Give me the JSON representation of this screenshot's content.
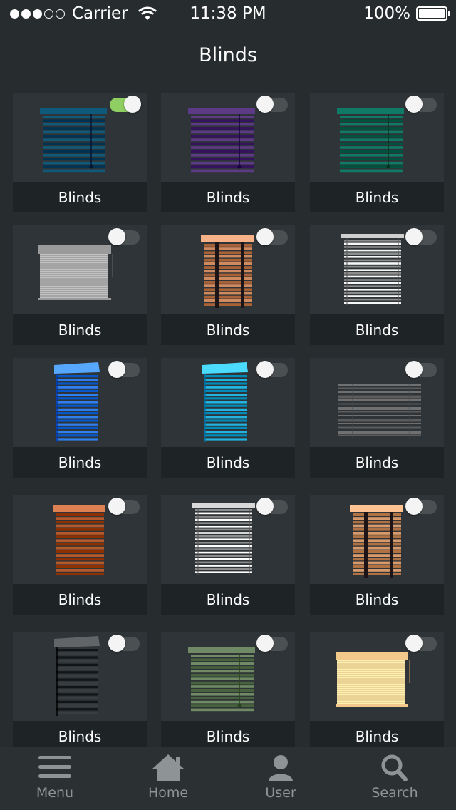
{
  "status_bar": {
    "carrier": "Carrier",
    "time": "11:38 PM",
    "battery": "100%"
  },
  "header": {
    "title": "Blinds"
  },
  "tiles": [
    {
      "label": "Blinds",
      "toggle_on": true,
      "art": "venetian",
      "color": "#0f5a7a"
    },
    {
      "label": "Blinds",
      "toggle_on": false,
      "art": "venetian",
      "color": "#5d3a86"
    },
    {
      "label": "Blinds",
      "toggle_on": false,
      "art": "venetian",
      "color": "#0f7a66"
    },
    {
      "label": "Blinds",
      "toggle_on": false,
      "art": "roller",
      "color": "#9a9a9a"
    },
    {
      "label": "Blinds",
      "toggle_on": false,
      "art": "wood",
      "color": "#d08a60"
    },
    {
      "label": "Blinds",
      "toggle_on": false,
      "art": "slat",
      "color": "#cfcfcf"
    },
    {
      "label": "Blinds",
      "toggle_on": false,
      "art": "slat3d",
      "color": "#2f7ff0"
    },
    {
      "label": "Blinds",
      "toggle_on": false,
      "art": "slat3d",
      "color": "#22b3e0"
    },
    {
      "label": "Blinds",
      "toggle_on": false,
      "art": "open",
      "color": "#707070"
    },
    {
      "label": "Blinds",
      "toggle_on": false,
      "art": "wood_plain",
      "color": "#b5582a"
    },
    {
      "label": "Blinds",
      "toggle_on": false,
      "art": "slat",
      "color": "#d8d8d8"
    },
    {
      "label": "Blinds",
      "toggle_on": false,
      "art": "wood",
      "color": "#d89a6a"
    },
    {
      "label": "Blinds",
      "toggle_on": false,
      "art": "slat3d",
      "color": "#3a3d40"
    },
    {
      "label": "Blinds",
      "toggle_on": false,
      "art": "venetian",
      "color": "#6f8a64"
    },
    {
      "label": "Blinds",
      "toggle_on": false,
      "art": "roller",
      "color": "#f1c98a"
    }
  ],
  "tabbar": {
    "tabs": [
      {
        "label": "Menu",
        "icon": "menu-icon"
      },
      {
        "label": "Home",
        "icon": "home-icon"
      },
      {
        "label": "User",
        "icon": "user-icon"
      },
      {
        "label": "Search",
        "icon": "search-icon"
      }
    ]
  }
}
